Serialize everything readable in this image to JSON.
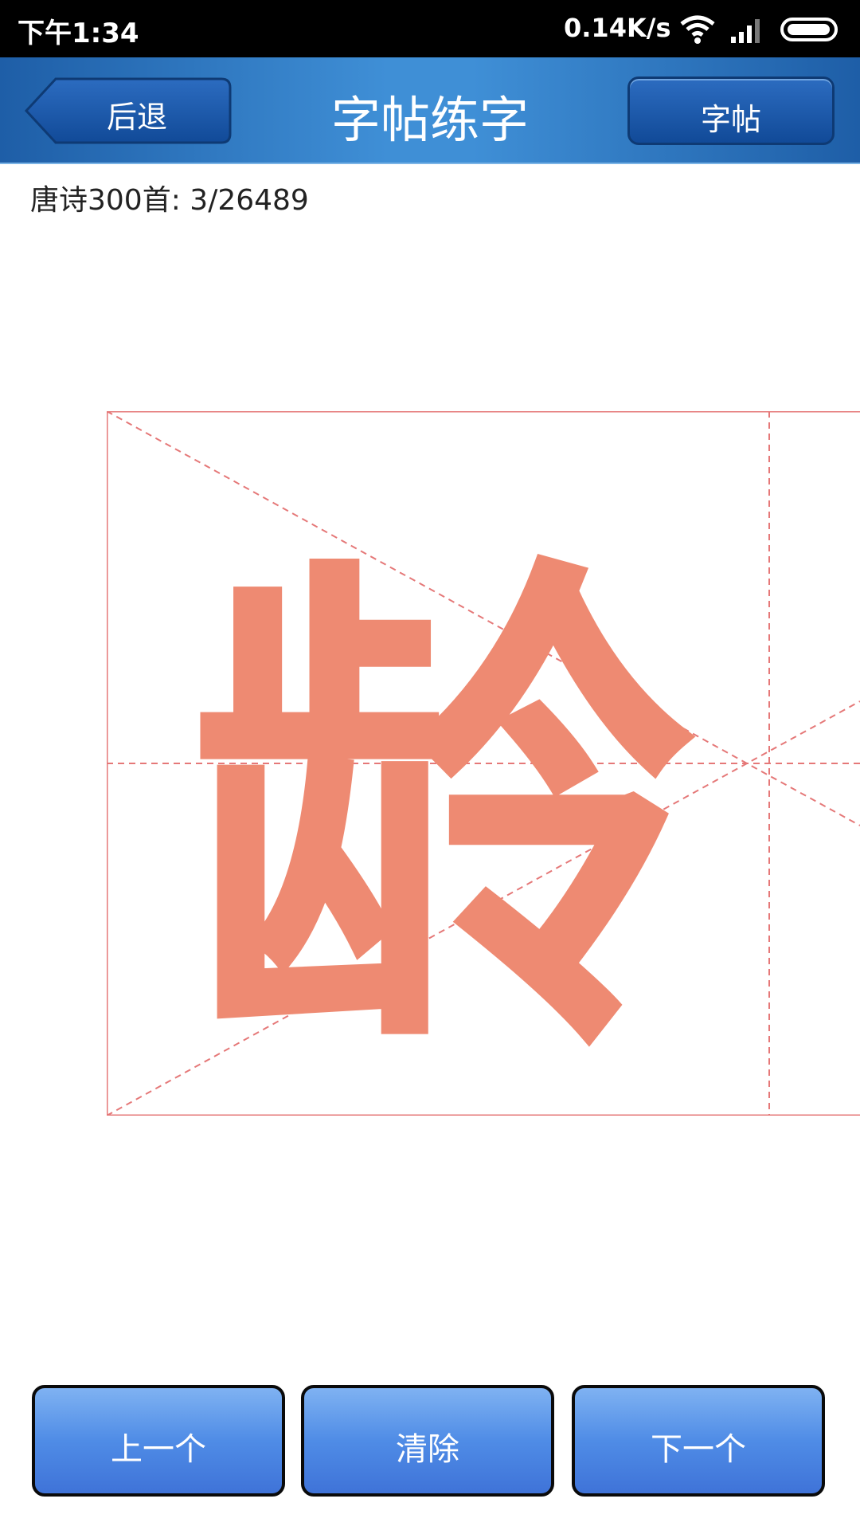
{
  "status_bar": {
    "time": "下午1:34",
    "network_speed": "0.14K/s",
    "icons": [
      "wifi-icon",
      "signal-icon",
      "battery-icon"
    ]
  },
  "header": {
    "back_label": "后退",
    "title": "字帖练字",
    "copybook_label": "字帖"
  },
  "progress": {
    "text": "唐诗300首: 3/26489"
  },
  "practice": {
    "character": "龄",
    "character_color": "#ee8a72",
    "grid_color": "#e57878"
  },
  "footer": {
    "prev_label": "上一个",
    "clear_label": "清除",
    "next_label": "下一个"
  },
  "colors": {
    "header_blue": "#2f78c4",
    "button_blue": "#4f8ce6"
  }
}
